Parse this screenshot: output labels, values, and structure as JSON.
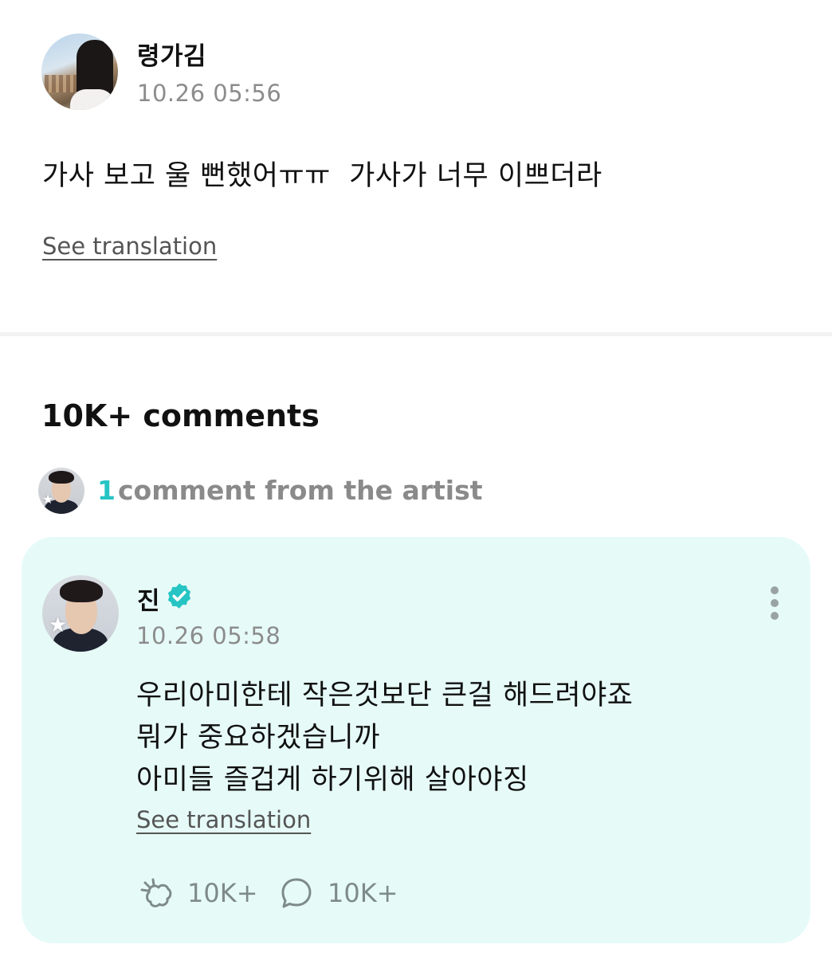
{
  "post": {
    "author": "령가김",
    "timestamp": "10.26 05:56",
    "text": "가사 보고 울 뻔했어ㅠㅠ  가사가 너무 이쁘더라",
    "see_translation": "See translation"
  },
  "comments": {
    "title": "10K+ comments",
    "artist_count": "1",
    "artist_label": "comment from the artist",
    "featured": {
      "author": "진",
      "timestamp": "10.26 05:58",
      "lines": [
        "우리아미한테 작은것보단 큰걸 해드려야죠",
        "뭐가 중요하겠습니까",
        "아미들 즐겁게 하기위해 살아야징"
      ],
      "see_translation": "See translation",
      "like_count": "10K+",
      "reply_count": "10K+"
    }
  },
  "colors": {
    "accent": "#27c4c4",
    "card_background": "#e6fbf7",
    "muted_text": "#8c8c8c"
  },
  "icons": [
    "verified-badge-icon",
    "more-options-icon",
    "reaction-icon",
    "comment-bubble-icon",
    "artist-star-icon"
  ]
}
